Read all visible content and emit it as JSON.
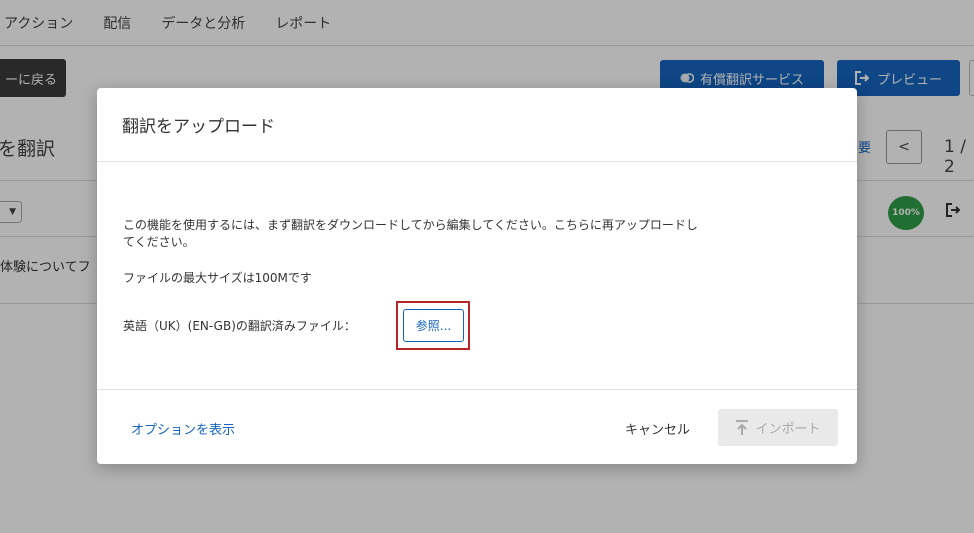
{
  "topnav": {
    "items": [
      "アクション",
      "配信",
      "データと分析",
      "レポート"
    ]
  },
  "toolbar": {
    "back_label": "ーに戻る",
    "paid_translation_label": "有償翻訳サービス",
    "preview_label": "プレビュー"
  },
  "background": {
    "title": "を翻訳",
    "row_text": "体験についてフ",
    "right_link": "要",
    "page_indicator": "1 / 2",
    "badge": "100%"
  },
  "modal": {
    "title": "翻訳をアップロード",
    "description": "この機能を使用するには、まず翻訳をダウンロードしてから編集してください。こちらに再アップロードしてください。",
    "max_size": "ファイルの最大サイズは100Mです",
    "file_label": "英語（UK）(EN-GB)の翻訳済みファイル：",
    "browse_label": "参照...",
    "show_options_label": "オプションを表示",
    "cancel_label": "キャンセル",
    "import_label": "インポート"
  },
  "colors": {
    "accent": "#1565c0",
    "highlight": "#b52525",
    "badge_green": "#2e9e47"
  },
  "icons": [
    "coins-icon",
    "preview-exit-icon",
    "chevron-left-icon",
    "exit-icon",
    "upload-icon",
    "caret-down-icon"
  ]
}
